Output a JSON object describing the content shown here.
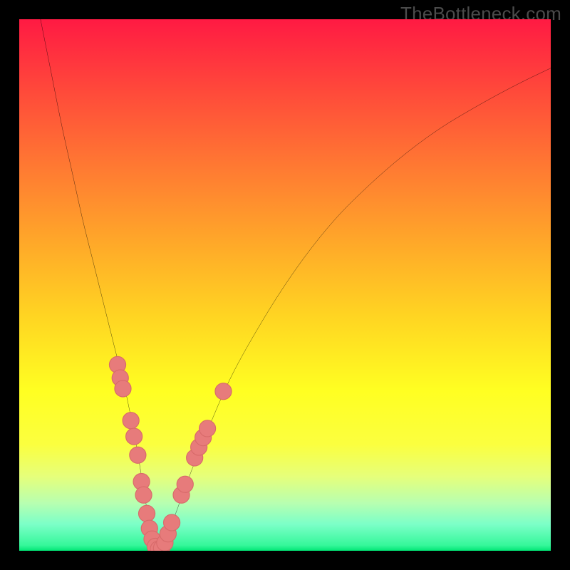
{
  "watermark": "TheBottleneck.com",
  "colors": {
    "frame": "#000000",
    "curve": "#000000",
    "marker_fill": "#e77b7b",
    "marker_stroke": "#d86a6a"
  },
  "chart_data": {
    "type": "line",
    "title": "",
    "xlabel": "",
    "ylabel": "",
    "xlim": [
      0,
      100
    ],
    "ylim": [
      0,
      100
    ],
    "series": [
      {
        "name": "bottleneck-curve",
        "x": [
          4,
          6,
          8,
          10,
          12,
          14,
          16,
          18,
          20,
          22,
          23,
          24,
          25,
          26,
          27,
          28,
          32,
          36,
          40,
          45,
          50,
          55,
          60,
          65,
          70,
          75,
          80,
          85,
          90,
          95,
          100
        ],
        "y": [
          100,
          90,
          80,
          71,
          62,
          54,
          46,
          38,
          30,
          20,
          14,
          8,
          3,
          0,
          0,
          3,
          14,
          24,
          33,
          42,
          50,
          57,
          63,
          68,
          72.5,
          76.5,
          80,
          83,
          85.8,
          88.4,
          90.8
        ]
      }
    ],
    "markers": [
      {
        "x": 18.5,
        "y": 35
      },
      {
        "x": 19.0,
        "y": 32.5
      },
      {
        "x": 19.5,
        "y": 30.5
      },
      {
        "x": 21.0,
        "y": 24.5
      },
      {
        "x": 21.6,
        "y": 21.5
      },
      {
        "x": 22.3,
        "y": 18
      },
      {
        "x": 23.0,
        "y": 13
      },
      {
        "x": 23.4,
        "y": 10.5
      },
      {
        "x": 24.0,
        "y": 7
      },
      {
        "x": 24.5,
        "y": 4.2
      },
      {
        "x": 25.0,
        "y": 2.2
      },
      {
        "x": 25.6,
        "y": 0.8
      },
      {
        "x": 26.2,
        "y": 0.3
      },
      {
        "x": 26.8,
        "y": 0.5
      },
      {
        "x": 27.4,
        "y": 1.5
      },
      {
        "x": 28.0,
        "y": 3.2
      },
      {
        "x": 28.7,
        "y": 5.3
      },
      {
        "x": 30.5,
        "y": 10.5
      },
      {
        "x": 31.2,
        "y": 12.5
      },
      {
        "x": 33.0,
        "y": 17.5
      },
      {
        "x": 33.8,
        "y": 19.5
      },
      {
        "x": 34.6,
        "y": 21.3
      },
      {
        "x": 35.4,
        "y": 23
      },
      {
        "x": 38.4,
        "y": 30
      }
    ],
    "marker_radius": 1.55
  }
}
